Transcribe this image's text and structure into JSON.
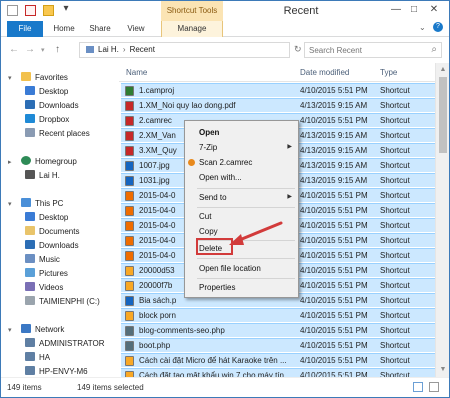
{
  "window": {
    "title": "Recent",
    "contextual_tab": "Shortcut Tools"
  },
  "ribbon": {
    "tabs": [
      "File",
      "Home",
      "Share",
      "View",
      "Manage"
    ]
  },
  "address": {
    "path": [
      "Lai H.",
      "Recent"
    ],
    "search_placeholder": "Search Recent"
  },
  "nav": {
    "favorites": "Favorites",
    "desktop": "Desktop",
    "downloads": "Downloads",
    "dropbox": "Dropbox",
    "recent_places": "Recent places",
    "homegroup": "Homegroup",
    "user": "Lai H.",
    "this_pc": "This PC",
    "pc_desktop": "Desktop",
    "documents": "Documents",
    "pc_downloads": "Downloads",
    "music": "Music",
    "pictures": "Pictures",
    "videos": "Videos",
    "drive_c": "TAIMIENPHI (C:)",
    "network": "Network",
    "net_1": "ADMINISTRATOR",
    "net_2": "HA",
    "net_3": "HP-ENVY-M6"
  },
  "columns": {
    "name": "Name",
    "date": "Date modified",
    "type": "Type"
  },
  "files": [
    {
      "name": "1.camproj",
      "date": "4/10/2015 5:51 PM",
      "type": "Shortcut",
      "icon": "camproj-icon",
      "color": "#2e7d32"
    },
    {
      "name": "1.XM_Noi quy lao dong.pdf",
      "date": "4/13/2015 9:15 AM",
      "type": "Shortcut",
      "icon": "pdf-icon",
      "color": "#c62828"
    },
    {
      "name": "2.camrec",
      "date": "4/10/2015 5:51 PM",
      "type": "Shortcut",
      "icon": "camrec-icon",
      "color": "#c62828"
    },
    {
      "name": "2.XM_Van",
      "date": "4/13/2015 9:15 AM",
      "type": "Shortcut",
      "icon": "pdf-icon",
      "color": "#c62828"
    },
    {
      "name": "3.XM_Quy",
      "date": "4/13/2015 9:15 AM",
      "type": "Shortcut",
      "icon": "pdf-icon",
      "color": "#c62828"
    },
    {
      "name": "1007.jpg",
      "date": "4/13/2015 9:15 AM",
      "type": "Shortcut",
      "icon": "image-icon",
      "color": "#1565c0"
    },
    {
      "name": "1031.jpg",
      "date": "4/13/2015 9:15 AM",
      "type": "Shortcut",
      "icon": "image-icon",
      "color": "#1565c0"
    },
    {
      "name": "2015-04-0",
      "date": "4/10/2015 5:51 PM",
      "type": "Shortcut",
      "icon": "video-icon",
      "color": "#ef6c00"
    },
    {
      "name": "2015-04-0",
      "date": "4/10/2015 5:51 PM",
      "type": "Shortcut",
      "icon": "video-icon",
      "color": "#ef6c00"
    },
    {
      "name": "2015-04-0",
      "date": "4/10/2015 5:51 PM",
      "type": "Shortcut",
      "icon": "video-icon",
      "color": "#ef6c00"
    },
    {
      "name": "2015-04-0",
      "date": "4/10/2015 5:51 PM",
      "type": "Shortcut",
      "icon": "video-icon",
      "color": "#ef6c00"
    },
    {
      "name": "2015-04-0",
      "date": "4/10/2015 5:51 PM",
      "type": "Shortcut",
      "icon": "video-icon",
      "color": "#ef6c00"
    },
    {
      "name": "20000d53",
      "date": "4/10/2015 5:51 PM",
      "type": "Shortcut",
      "icon": "folder-icon",
      "color": "#f9a825"
    },
    {
      "name": "20000f7b",
      "date": "4/10/2015 5:51 PM",
      "type": "Shortcut",
      "icon": "folder-icon",
      "color": "#f9a825"
    },
    {
      "name": "Bia sách.p",
      "date": "4/10/2015 5:51 PM",
      "type": "Shortcut",
      "icon": "image-icon",
      "color": "#1565c0"
    },
    {
      "name": "block porn",
      "date": "4/10/2015 5:51 PM",
      "type": "Shortcut",
      "icon": "folder-icon",
      "color": "#f9a825"
    },
    {
      "name": "blog-comments-seo.php",
      "date": "4/10/2015 5:51 PM",
      "type": "Shortcut",
      "icon": "php-icon",
      "color": "#546e7a"
    },
    {
      "name": "boot.php",
      "date": "4/10/2015 5:51 PM",
      "type": "Shortcut",
      "icon": "php-icon",
      "color": "#546e7a"
    },
    {
      "name": "Cách cài đặt Micro để hát Karaoke trên ...",
      "date": "4/10/2015 5:51 PM",
      "type": "Shortcut",
      "icon": "folder-icon",
      "color": "#f9a825"
    },
    {
      "name": "Cách đặt tạo mật khẩu win 7 cho máy tín...",
      "date": "4/10/2015 5:51 PM",
      "type": "Shortcut",
      "icon": "folder-icon",
      "color": "#f9a825"
    }
  ],
  "context_menu": {
    "open": "Open",
    "seven_zip": "7-Zip",
    "scan": "Scan 2.camrec",
    "open_with": "Open with...",
    "send_to": "Send to",
    "cut": "Cut",
    "copy": "Copy",
    "delete": "Delete",
    "open_location": "Open file location",
    "properties": "Properties"
  },
  "status": {
    "count": "149 items",
    "selected": "149 items selected"
  },
  "colors": {
    "selection": "#cce8ff",
    "accent": "#1979ca",
    "annotation": "#d23b3b"
  }
}
